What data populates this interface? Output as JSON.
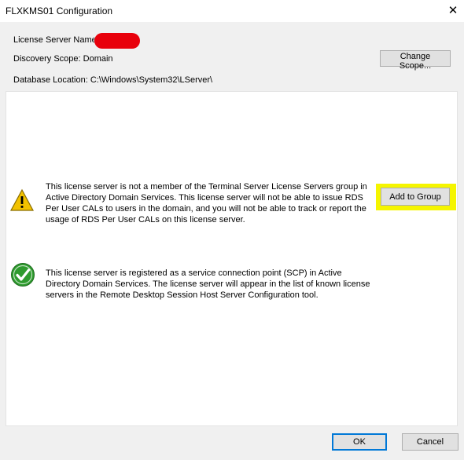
{
  "window": {
    "title": "FLXKMS01 Configuration",
    "close_glyph": "✕"
  },
  "header": {
    "server_name_label": "License Server Name:",
    "discovery_scope": "Discovery Scope: Domain",
    "database_location": "Database Location: C:\\Windows\\System32\\LServer\\",
    "change_scope_label": "Change Scope..."
  },
  "messages": {
    "warning_text": "This license server is not a member of the Terminal Server License Servers group in Active Directory Domain Services. This license server will not be able to issue RDS Per User CALs to users in the domain, and you will not be able to track or report the usage of RDS Per User CALs on this license server.",
    "add_to_group_label": "Add to Group",
    "success_text": "This license server is registered as a service connection point (SCP) in Active Directory Domain Services. The license server will appear in the list of known license servers in the Remote Desktop Session Host Server Configuration tool."
  },
  "footer": {
    "ok_label": "OK",
    "cancel_label": "Cancel"
  },
  "icons": {
    "warning": "warning-triangle-icon",
    "success": "check-circle-icon"
  },
  "colors": {
    "highlight": "#f5f500",
    "redaction": "#e8000b",
    "check_green": "#2e9b2e",
    "warning_yellow": "#f2c200"
  }
}
